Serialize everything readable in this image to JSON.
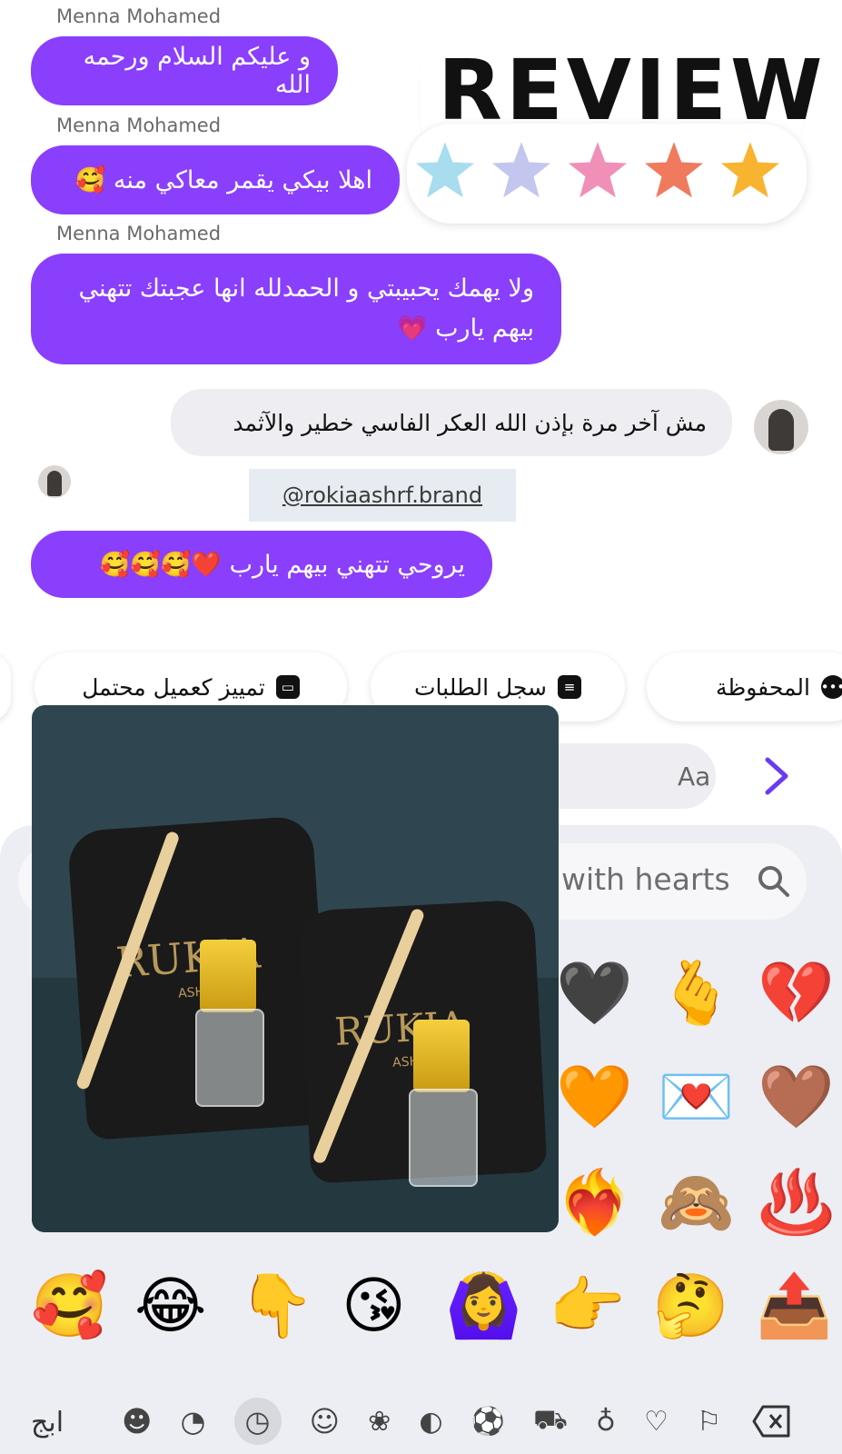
{
  "chat": {
    "messages": [
      {
        "sender": "Menna Mohamed",
        "text": "و عليكم السلام ورحمه الله"
      },
      {
        "sender": "Menna Mohamed",
        "text": "اهلا بيكي يقمر معاكي منه 🥰"
      },
      {
        "sender": "Menna Mohamed",
        "line1": "ولا يهمك يحبيبتي و الحمدلله انها عجبتك تتهني",
        "line2": "بيهم يارب 💗"
      }
    ],
    "incoming": {
      "text": "مش آخر مرة بإذن الله العكر الفاسي خطير والآثمد"
    },
    "link": "@rokiaashrf.brand",
    "last_outgoing": "يروحي تتهني بيهم يارب ❤️🥰🥰🥰"
  },
  "sticker": {
    "title": "REVIEW",
    "star_colors": [
      "#a8dcef",
      "#c3c6ee",
      "#f08fb8",
      "#f07a5e",
      "#f8b431"
    ]
  },
  "quick_actions": [
    {
      "label": "المحفوظة",
      "icon": "saved-replies-icon"
    },
    {
      "label": "سجل الطلبات",
      "icon": "order-history-icon"
    },
    {
      "label": "تمييز كعميل محتمل",
      "icon": "lead-tag-icon"
    }
  ],
  "composer": {
    "placeholder": "Aa"
  },
  "emoji_panel": {
    "search_text": "with hearts",
    "visible_grid": [
      "🖤",
      "🫰",
      "💔",
      "🧡",
      "💌",
      "🤎",
      "❤️‍🔥",
      "🙈",
      "♨️"
    ],
    "recent_row": [
      "🥰",
      "😂",
      "👇",
      "😘",
      "🙆‍♀️",
      "👉",
      "🤔",
      "📤"
    ],
    "category_bar": {
      "abc_label": "ابج",
      "icons": [
        "smiley-cool-icon",
        "sticker-icon",
        "clock-icon",
        "smiley-icon",
        "dog-icon",
        "apple-icon",
        "ball-icon",
        "car-icon",
        "lightbulb-icon",
        "heart-icon",
        "flag-icon",
        "backspace-icon"
      ]
    }
  },
  "product_photo": {
    "brand_text": "RUKIA",
    "sub_text": "ASH"
  },
  "colors": {
    "outgoing_bubble": "#8a3ffc",
    "incoming_bubble": "#eeeef2",
    "accent": "#6a3cf0"
  }
}
